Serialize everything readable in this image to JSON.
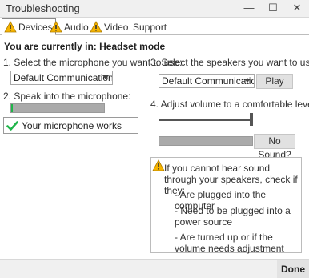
{
  "window": {
    "title": "Troubleshooting",
    "minimize": "—",
    "maximize": "☐",
    "close": "✕"
  },
  "tabs": [
    {
      "label": "Devices"
    },
    {
      "label": "Audio"
    },
    {
      "label": "Video"
    },
    {
      "label": "Support"
    }
  ],
  "status_text": "You are currently in: Headset mode",
  "microphone": {
    "select_label": "1. Select the microphone you want to use:",
    "selected": "Default Communication D...",
    "speak_label": "2. Speak into the microphone:",
    "level_fraction": 0.02,
    "works_text": "Your microphone works"
  },
  "speakers": {
    "select_label": "3. Select the speakers you want to use:",
    "selected": "Default Communication...",
    "play_label": "Play",
    "volume_label": "4. Adjust volume to a comfortable level:",
    "volume_fraction": 1.0,
    "no_sound_label": "No Sound?"
  },
  "help": {
    "intro": "If you cannot hear sound through your speakers, check if they:",
    "items": [
      "- Are plugged into the computer",
      "- Need to be plugged into a power source",
      "- Are turned up or if the volume needs adjustment"
    ]
  },
  "footer": {
    "done_label": "Done"
  },
  "colors": {
    "warning": "#f6b400",
    "success": "#1fb54a"
  }
}
